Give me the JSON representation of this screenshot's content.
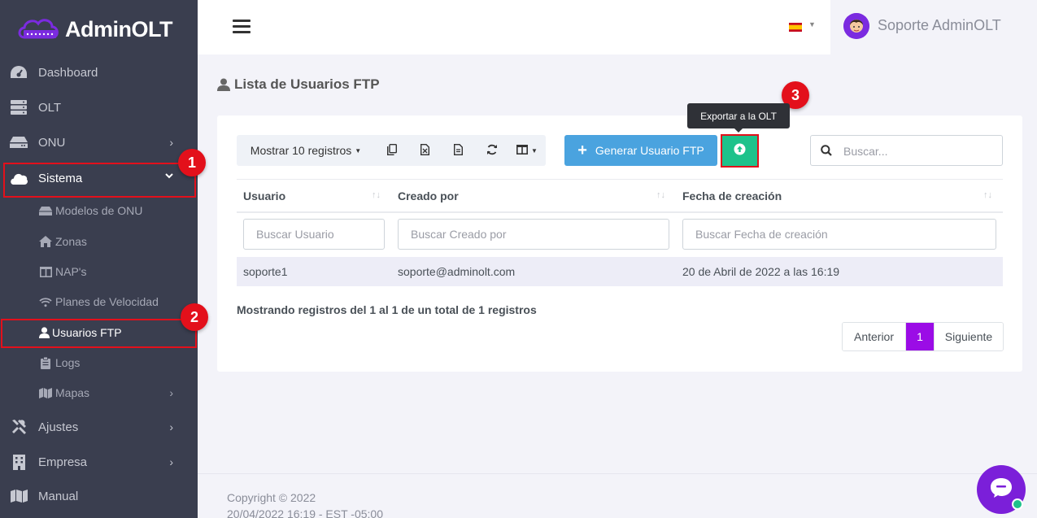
{
  "brand": {
    "name": "AdminOLT"
  },
  "sidebar": {
    "items": [
      {
        "label": "Dashboard",
        "icon": "dashboard-gauge-icon"
      },
      {
        "label": "OLT",
        "icon": "server-icon"
      },
      {
        "label": "ONU",
        "icon": "router-icon",
        "chevron": "›"
      },
      {
        "label": "Sistema",
        "icon": "cloud-icon",
        "chevron": "⌄",
        "expanded": true
      },
      {
        "label": "Ajustes",
        "icon": "tools-icon",
        "chevron": "›"
      },
      {
        "label": "Empresa",
        "icon": "building-icon",
        "chevron": "›"
      },
      {
        "label": "Manual",
        "icon": "book-map-icon"
      }
    ],
    "subitems": [
      {
        "label": "Modelos de ONU",
        "icon": "router-icon"
      },
      {
        "label": "Zonas",
        "icon": "home-icon"
      },
      {
        "label": "NAP's",
        "icon": "columns-icon"
      },
      {
        "label": "Planes de Velocidad",
        "icon": "wifi-icon"
      },
      {
        "label": "Usuarios FTP",
        "icon": "user-icon",
        "active": true
      },
      {
        "label": "Logs",
        "icon": "clipboard-icon"
      },
      {
        "label": "Mapas",
        "icon": "map-icon",
        "chevron": "›"
      }
    ]
  },
  "annotations": [
    "1",
    "2",
    "3"
  ],
  "topbar": {
    "language_flag": "es-flag",
    "user_name": "Soporte AdminOLT"
  },
  "page": {
    "title": "Lista de Usuarios FTP"
  },
  "toolbar": {
    "show_label": "Mostrar 10 registros",
    "generate_label": "Generar Usuario FTP",
    "export_tooltip": "Exportar a la OLT",
    "search_placeholder": "Buscar..."
  },
  "table": {
    "columns": [
      {
        "label": "Usuario",
        "filter_placeholder": "Buscar Usuario"
      },
      {
        "label": "Creado por",
        "filter_placeholder": "Buscar Creado por"
      },
      {
        "label": "Fecha de creación",
        "filter_placeholder": "Buscar Fecha de creación"
      }
    ],
    "rows": [
      [
        "soporte1",
        "soporte@adminolt.com",
        "20 de Abril de 2022 a las 16:19"
      ]
    ],
    "sort_glyph": "↑↓"
  },
  "info": "Mostrando registros del 1 al 1 de un total de 1 registros",
  "pagination": {
    "prev": "Anterior",
    "current": "1",
    "next": "Siguiente"
  },
  "footer": {
    "copyright": "Copyright © 2022",
    "timestamp": "20/04/2022 16:19 - EST -05:00"
  },
  "colors": {
    "sidebar": "#3a3e4f",
    "accent": "#9b0ce6",
    "primary": "#4aa3df",
    "success": "#1ec28b",
    "highlight": "#e3101b"
  }
}
